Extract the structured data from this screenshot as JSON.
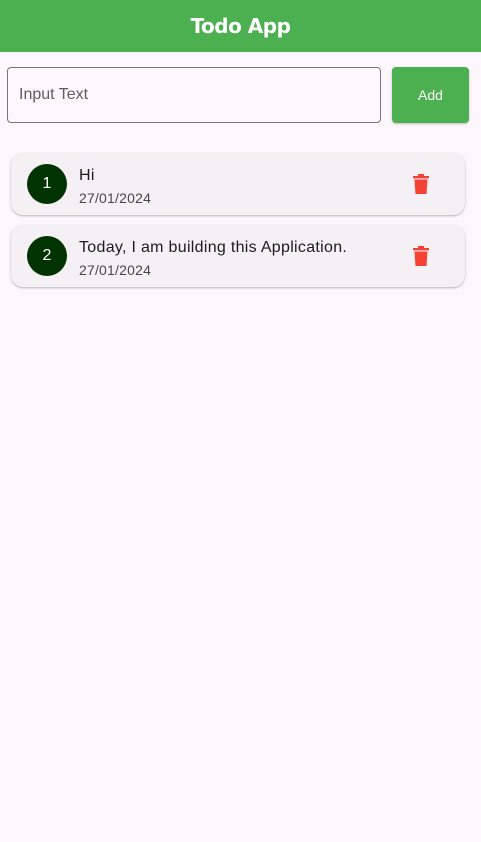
{
  "app_bar": {
    "title": "Todo App",
    "color": "#4caf50"
  },
  "input": {
    "value": "",
    "placeholder": "Input Text"
  },
  "add_button": {
    "label": "Add"
  },
  "todos": [
    {
      "index": "1",
      "text": "Hi",
      "date": "27/01/2024",
      "icon": "delete-icon"
    },
    {
      "index": "2",
      "text": "Today, I am building this Application.",
      "date": "27/01/2024",
      "icon": "delete-icon"
    }
  ],
  "colors": {
    "accent": "#4caf50",
    "avatar": "#003300",
    "delete": "#f44336",
    "background": "#fdf7fd",
    "card": "#f4f0f4"
  }
}
